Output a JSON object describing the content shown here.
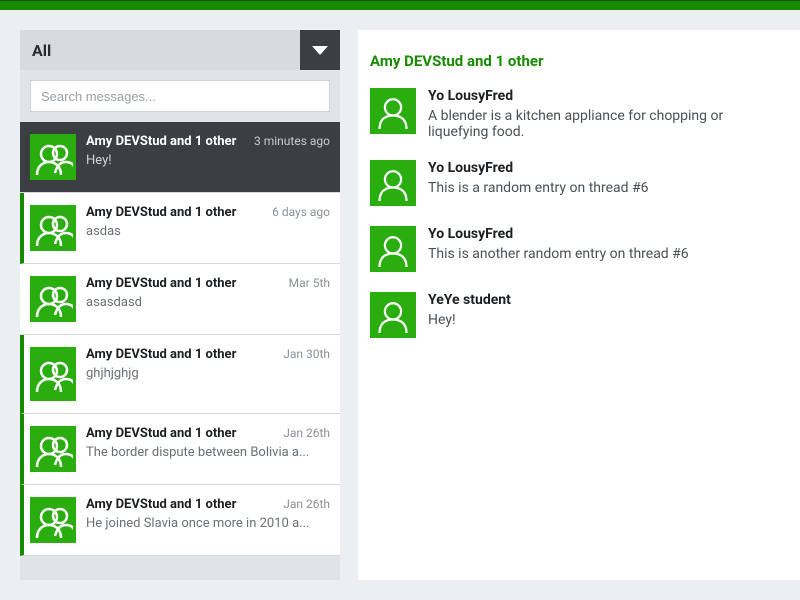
{
  "filter": {
    "label": "All"
  },
  "search": {
    "placeholder": "Search messages..."
  },
  "threads": [
    {
      "title": "Amy DEVStud and 1 other",
      "time": "3 minutes ago",
      "preview": "Hey!"
    },
    {
      "title": "Amy DEVStud and 1 other",
      "time": "6 days ago",
      "preview": "asdas"
    },
    {
      "title": "Amy DEVStud and 1 other",
      "time": "Mar 5th",
      "preview": "asasdasd"
    },
    {
      "title": "Amy DEVStud and 1 other",
      "time": "Jan 30th",
      "preview": "ghjhjghjg"
    },
    {
      "title": "Amy DEVStud and 1 other",
      "time": "Jan 26th",
      "preview": "The border dispute between Bolivia a..."
    },
    {
      "title": "Amy DEVStud and 1 other",
      "time": "Jan 26th",
      "preview": "He joined Slavia once more in 2010 a..."
    }
  ],
  "conversation": {
    "title": "Amy DEVStud and 1 other",
    "messages": [
      {
        "author": "Yo LousyFred",
        "text": "A blender is a kitchen appliance for chopping or liquefying food."
      },
      {
        "author": "Yo LousyFred",
        "text": "This is a random entry on thread #6"
      },
      {
        "author": "Yo LousyFred",
        "text": "This is another random entry on thread #6"
      },
      {
        "author": "YeYe student",
        "text": "Hey!"
      }
    ]
  }
}
